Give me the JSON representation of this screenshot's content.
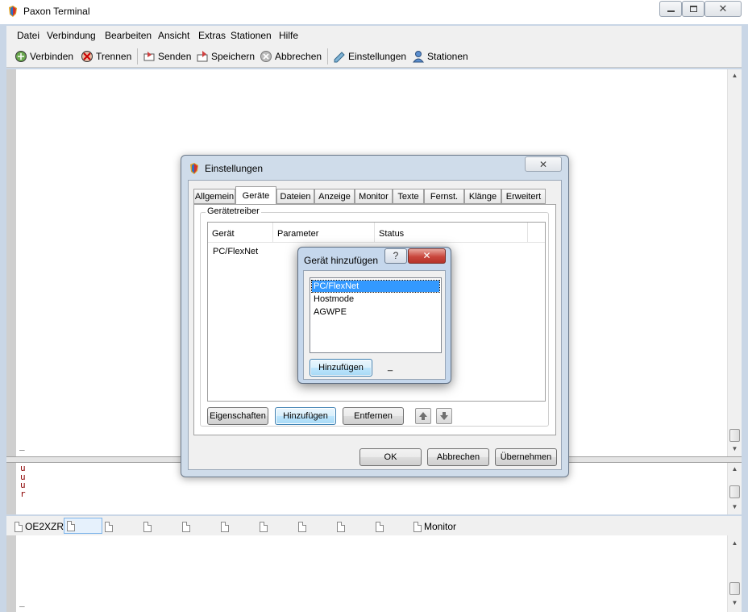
{
  "window": {
    "title": "Paxon Terminal"
  },
  "menu": [
    "Datei",
    "Verbindung",
    "Bearbeiten",
    "Ansicht",
    "Extras",
    "Stationen",
    "Hilfe"
  ],
  "toolbar": {
    "connect": "Verbinden",
    "disconnect": "Trennen",
    "send": "Senden",
    "save": "Speichern",
    "abort": "Abbrechen",
    "settings": "Einstellungen",
    "stations": "Stationen"
  },
  "terminal": {
    "cursor_top": "_",
    "mid_lines": [
      "u",
      "u",
      "u",
      "r"
    ],
    "cursor_bottom": "_"
  },
  "status_tabs": {
    "callsign": "OE2XZR",
    "monitor": "Monitor"
  },
  "settings_dialog": {
    "title": "Einstellungen",
    "tabs": [
      "Allgemein",
      "Geräte",
      "Dateien",
      "Anzeige",
      "Monitor",
      "Texte",
      "Fernst.",
      "Klänge",
      "Erweitert"
    ],
    "active_tab": "Geräte",
    "group_title": "Gerätetreiber",
    "columns": [
      "Gerät",
      "Parameter",
      "Status"
    ],
    "rows": [
      {
        "device": "PC/FlexNet",
        "parameter": "",
        "status": ""
      }
    ],
    "buttons": {
      "properties": "Eigenschaften",
      "add": "Hinzufügen",
      "remove": "Entfernen",
      "ok": "OK",
      "cancel": "Abbrechen",
      "apply": "Übernehmen"
    }
  },
  "add_device_dialog": {
    "title": "Gerät hinzufügen",
    "help": "?",
    "options": [
      "PC/FlexNet",
      "Hostmode",
      "AGWPE"
    ],
    "selected": "PC/FlexNet",
    "add_button": "Hinzufügen",
    "trailing": "_"
  },
  "colors": {
    "selection": "#3399ff",
    "terminal_text": "#8b0000",
    "close_button": "#c9463d"
  }
}
